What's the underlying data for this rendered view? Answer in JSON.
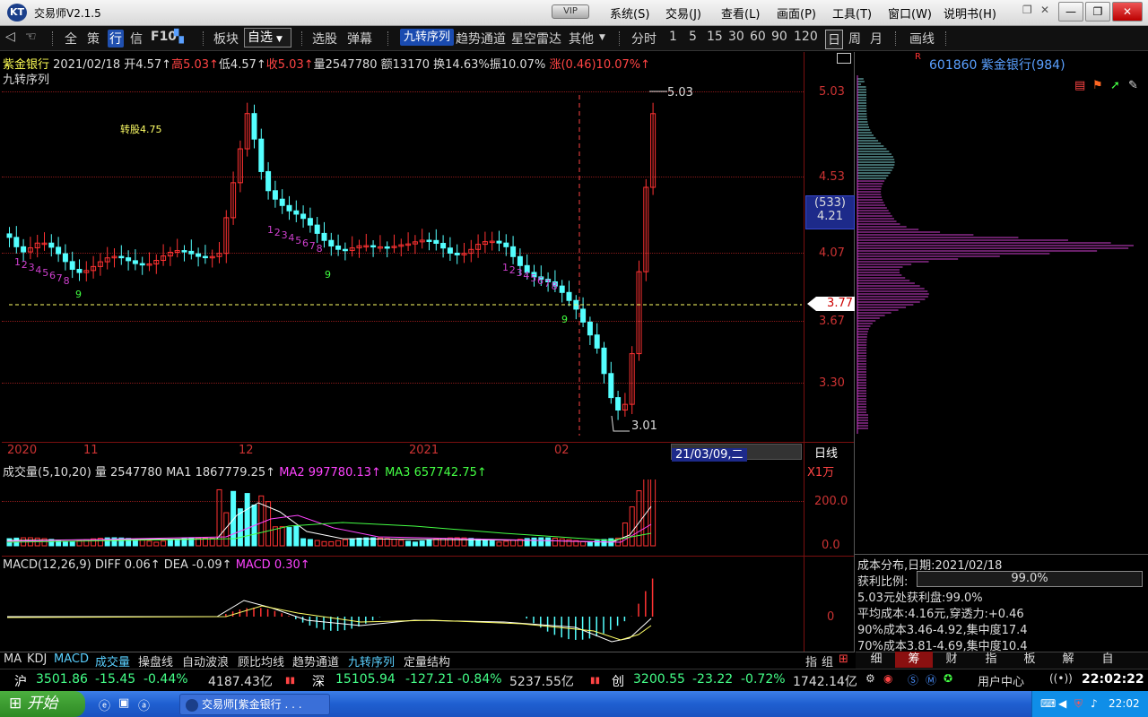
{
  "app": {
    "title": "交易师V2.1.5",
    "logo": "KT",
    "vip": "VIP"
  },
  "menus": [
    "系统(S)",
    "交易(J)",
    "查看(L)",
    "画面(P)",
    "工具(T)",
    "窗口(W)",
    "说明书(H)"
  ],
  "window_buttons": [
    "—",
    "❐",
    "✕"
  ],
  "toolbar": {
    "items_left": [
      "全",
      "策",
      "行",
      "信",
      "F10",
      "板块"
    ],
    "active_item": "行",
    "dropdown": "自选",
    "items_mid": [
      "选股",
      "弹幕"
    ],
    "jiuzhuan": "九转序列",
    "items_mid2": [
      "趋势通道",
      "星空雷达",
      "其他"
    ],
    "periods": [
      "分时",
      "1",
      "5",
      "15",
      "30",
      "60",
      "90",
      "120",
      "日",
      "周",
      "月"
    ],
    "active_period": "日",
    "draw": "画线"
  },
  "header": {
    "stock_name": "紫金银行",
    "date": "2021/02/18",
    "open": "开4.57↑",
    "high": "高5.03↑",
    "low": "低4.57↑",
    "close": "收5.03↑",
    "volume": "量2547780",
    "amount": "额13170",
    "turnover": "换14.63%",
    "amplitude": "振10.07%",
    "change": "涨(0.46)10.07%↑",
    "indicator": "九转序列"
  },
  "main_chart": {
    "annotation": "转股4.75",
    "price_axis": [
      "5.03",
      "4.53",
      "4.07",
      "3.67",
      "3.30"
    ],
    "crosshair_box": [
      "(533)",
      "4.21"
    ],
    "current_price": "3.77",
    "high_label": "5.03",
    "low_label": "3.01",
    "time_axis": [
      "2020",
      "11",
      "12",
      "2021",
      "02"
    ],
    "cursor_date": "21/03/09,二",
    "period_label": "日线",
    "seq_labels": [
      {
        "t": "1",
        "c": "#d040d0"
      },
      {
        "t": "2",
        "c": "#d040d0"
      },
      {
        "t": "3",
        "c": "#d040d0"
      },
      {
        "t": "4",
        "c": "#d040d0"
      },
      {
        "t": "5",
        "c": "#d040d0"
      },
      {
        "t": "6",
        "c": "#d040d0"
      },
      {
        "t": "7",
        "c": "#d040d0"
      },
      {
        "t": "8",
        "c": "#d040d0"
      },
      {
        "t": "9",
        "c": "#40ff40"
      }
    ]
  },
  "volume_panel": {
    "title": "成交量(5,10,20)",
    "vol": "量 2547780",
    "ma1": "MA1 1867779.25↑",
    "ma2": "MA2 997780.13↑",
    "ma3": "MA3 657742.75↑",
    "unit": "X1万",
    "axis": [
      "200.0",
      "0.0"
    ]
  },
  "macd_panel": {
    "title": "MACD(12,26,9)",
    "diff": "DIFF 0.06↑",
    "dea": "DEA -0.09↑",
    "macd": "MACD 0.30↑",
    "axis": [
      "0"
    ]
  },
  "right_panel": {
    "code_name": "601860 紫金银行(984)",
    "r_mark": "R",
    "cost_title": "成本分布,日期:2021/02/18",
    "profit_label": "获利比例:",
    "profit_value": "99.0%",
    "lines": [
      "5.03元处获利盘:99.0%",
      "平均成本:4.16元,穿透力:+0.46",
      "90%成本3.46-4.92,集中度17.4",
      "70%成本3.81-4.69,集中度10.4"
    ],
    "tabs": [
      "细",
      "筹",
      "财",
      "指",
      "板",
      "解",
      "自"
    ],
    "active_tab": "筹"
  },
  "bottom_tabs": [
    "MA",
    "KDJ",
    "MACD",
    "成交量",
    "操盘线",
    "自动波浪",
    "顾比均线",
    "趋势通道",
    "九转序列",
    "定量结构"
  ],
  "bottom_right_tabs": [
    "指",
    "组"
  ],
  "index_bar": {
    "sh": {
      "name": "沪",
      "value": "3501.86",
      "change": "-15.45",
      "pct": "-0.44%",
      "amount": "4187.43亿"
    },
    "sz": {
      "name": "深",
      "value": "15105.94",
      "change": "-127.21",
      "pct": "-0.84%",
      "amount": "5237.55亿"
    },
    "cy": {
      "name": "创",
      "value": "3200.55",
      "change": "-23.22",
      "pct": "-0.72%",
      "amount": "1742.14亿"
    },
    "user_center": "用户中心",
    "clock": "22:02:22"
  },
  "taskbar": {
    "start": "开始",
    "task": "交易师[紫金银行 . . .",
    "clock": "22:02"
  },
  "colors": {
    "up": "#ff3232",
    "down": "#54ffff",
    "grid": "#8a1a1a",
    "ma1": "#ffffff",
    "ma2": "#ff44ff",
    "ma3": "#44ff44"
  }
}
